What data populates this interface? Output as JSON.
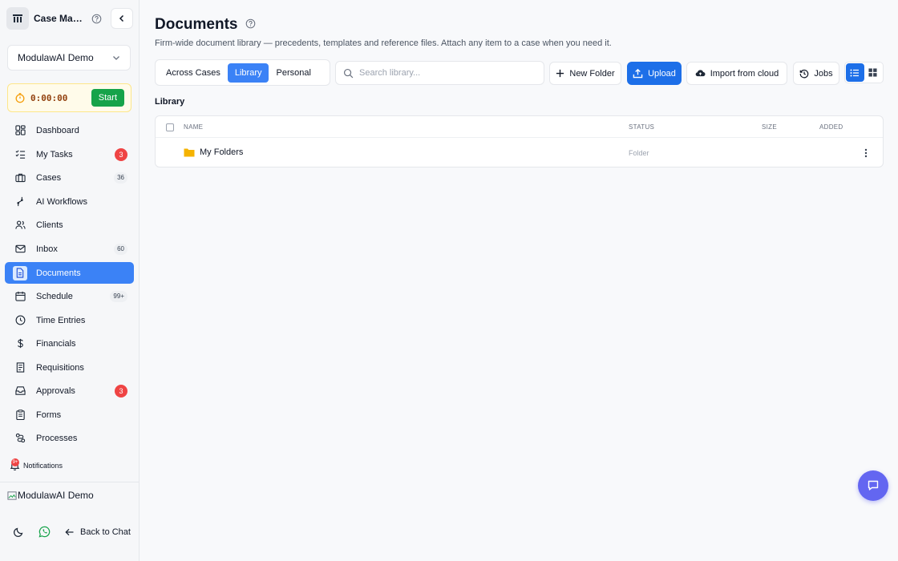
{
  "sidebar": {
    "brand_title": "Case Management",
    "workspace": "ModulawAI Demo",
    "timer": {
      "value": "0:00:00",
      "start_label": "Start"
    },
    "items": [
      {
        "label": "Dashboard",
        "icon": "dashboard-icon"
      },
      {
        "label": "My Tasks",
        "icon": "tasks-icon",
        "badge": "3",
        "badge_style": "red"
      },
      {
        "label": "Cases",
        "icon": "briefcase-icon",
        "badge": "36",
        "badge_style": "gray"
      },
      {
        "label": "AI Workflows",
        "icon": "workflow-icon"
      },
      {
        "label": "Clients",
        "icon": "users-icon"
      },
      {
        "label": "Inbox",
        "icon": "mail-icon",
        "badge": "60",
        "badge_style": "gray"
      },
      {
        "label": "Documents",
        "icon": "document-icon",
        "active": true
      },
      {
        "label": "Schedule",
        "icon": "calendar-icon",
        "badge": "99+",
        "badge_style": "gray"
      },
      {
        "label": "Time Entries",
        "icon": "clock-icon"
      },
      {
        "label": "Financials",
        "icon": "dollar-icon"
      },
      {
        "label": "Requisitions",
        "icon": "receipt-icon"
      },
      {
        "label": "Approvals",
        "icon": "inbox-tray-icon",
        "badge": "3",
        "badge_style": "red"
      },
      {
        "label": "Forms",
        "icon": "clipboard-icon"
      },
      {
        "label": "Processes",
        "icon": "process-icon"
      }
    ],
    "notifications": {
      "label": "Notifications",
      "badge": "9+"
    },
    "user_image_alt": "ModulawAI Demo",
    "back_to_chat": "Back to Chat"
  },
  "main": {
    "title": "Documents",
    "subtitle": "Firm-wide document library — precedents, templates and reference files. Attach any item to a case when you need it.",
    "scope_tabs": [
      {
        "label": "Across Cases",
        "active": false
      },
      {
        "label": "Library",
        "active": true
      },
      {
        "label": "Personal",
        "active": false
      }
    ],
    "search": {
      "placeholder": "Search library...",
      "value": ""
    },
    "actions": {
      "new_folder": "New Folder",
      "upload": "Upload",
      "import_cloud": "Import from cloud",
      "jobs": "Jobs"
    },
    "view_mode": "list",
    "section_label": "Library",
    "table": {
      "columns": [
        "NAME",
        "STATUS",
        "SIZE",
        "ADDED"
      ],
      "rows": [
        {
          "name": "My Folders",
          "status": "Folder",
          "size": "",
          "added": ""
        }
      ]
    }
  },
  "colors": {
    "accent": "#3b82f6",
    "primary_button": "#1d6fe8",
    "start_button": "#16a34a",
    "badge_red": "#ef4444",
    "folder": "#f5b301",
    "chat_fab": "#6366f1"
  }
}
